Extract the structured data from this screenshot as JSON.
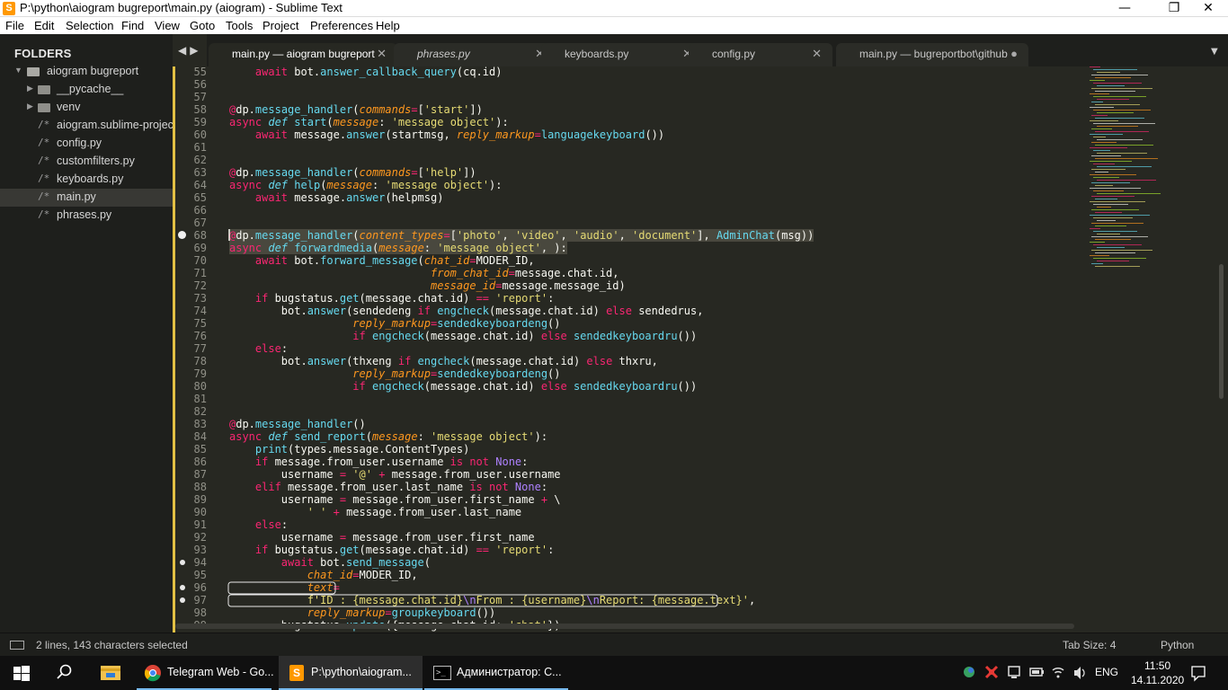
{
  "window": {
    "title": "P:\\python\\aiogram bugreport\\main.py (aiogram) - Sublime Text",
    "minimize": "—",
    "maximize": "❐",
    "close": "✕"
  },
  "menu": [
    "File",
    "Edit",
    "Selection",
    "Find",
    "View",
    "Goto",
    "Tools",
    "Project",
    "Preferences",
    "Help"
  ],
  "sidebar": {
    "header": "FOLDERS",
    "items": [
      {
        "label": "aiogram bugreport",
        "kind": "folder-open",
        "depth": 0
      },
      {
        "label": "__pycache__",
        "kind": "folder",
        "depth": 1
      },
      {
        "label": "venv",
        "kind": "folder",
        "depth": 1
      },
      {
        "label": "aiogram.sublime-project",
        "kind": "file",
        "depth": 1
      },
      {
        "label": "config.py",
        "kind": "file",
        "depth": 1
      },
      {
        "label": "customfilters.py",
        "kind": "file",
        "depth": 1
      },
      {
        "label": "keyboards.py",
        "kind": "file",
        "depth": 1
      },
      {
        "label": "main.py",
        "kind": "file",
        "depth": 1,
        "selected": true
      },
      {
        "label": "phrases.py",
        "kind": "file",
        "depth": 1
      }
    ],
    "nav_back": "◀",
    "nav_forward": "▶"
  },
  "tabs": [
    {
      "label": "main.py — aiogram bugreport",
      "close": "✕",
      "active": true
    },
    {
      "label": "phrases.py",
      "close": "✕",
      "italic": true
    },
    {
      "label": "keyboards.py",
      "close": "✕"
    },
    {
      "label": "config.py",
      "close": "✕"
    },
    {
      "label": "main.py — bugreportbot\\github",
      "close": "●"
    }
  ],
  "tab_dropdown": "▼",
  "code_lines": [
    {
      "n": "55",
      "html": "    <span class=\"kw\">await</span> bot.<span class=\"f\">answer_callback_query</span>(cq.id)"
    },
    {
      "n": "56",
      "html": ""
    },
    {
      "n": "57",
      "html": ""
    },
    {
      "n": "58",
      "html": "<span class=\"kw\">@</span>dp.<span class=\"f\">message_handler</span>(<span class=\"p\">commands</span><span class=\"kw\">=</span>[<span class=\"s\">'start'</span>])"
    },
    {
      "n": "59",
      "html": "<span class=\"kw\">async</span> <span class=\"k\">def</span> <span class=\"f\">start</span>(<span class=\"p\">message</span>: <span class=\"s\">'message object'</span>):"
    },
    {
      "n": "60",
      "html": "    <span class=\"kw\">await</span> message.<span class=\"f\">answer</span>(startmsg, <span class=\"p\">reply_markup</span><span class=\"kw\">=</span><span class=\"f\">languagekeyboard</span>())"
    },
    {
      "n": "61",
      "html": ""
    },
    {
      "n": "62",
      "html": ""
    },
    {
      "n": "63",
      "html": "<span class=\"kw\">@</span>dp.<span class=\"f\">message_handler</span>(<span class=\"p\">commands</span><span class=\"kw\">=</span>[<span class=\"s\">'help'</span>])"
    },
    {
      "n": "64",
      "html": "<span class=\"kw\">async</span> <span class=\"k\">def</span> <span class=\"f\">help</span>(<span class=\"p\">message</span>: <span class=\"s\">'message object'</span>):"
    },
    {
      "n": "65",
      "html": "    <span class=\"kw\">await</span> message.<span class=\"f\">answer</span>(helpmsg)"
    },
    {
      "n": "66",
      "html": ""
    },
    {
      "n": "67",
      "html": ""
    },
    {
      "n": "68",
      "dot": "big",
      "html": "<span class=\"hl\"><span class=\"kw\">@</span>dp.<span class=\"f\">message_handler</span>(<span class=\"p\">content_types</span><span class=\"kw\">=</span>[<span class=\"s\">'photo'</span>, <span class=\"s\">'video'</span>, <span class=\"s\">'audio'</span>, <span class=\"s\">'document'</span>], <span class=\"f\">AdminChat</span>(msg))</span>"
    },
    {
      "n": "69",
      "html": "<span class=\"hl\"><span class=\"kw\">async</span> <span class=\"k\">def</span> <span class=\"f\">forwardmedia</span>(<span class=\"p\">message</span>: <span class=\"s\">'message object'</span>, ):</span>"
    },
    {
      "n": "70",
      "html": "    <span class=\"kw\">await</span> bot.<span class=\"f\">forward_message</span>(<span class=\"p\">chat_id</span><span class=\"kw\">=</span>MODER_ID,"
    },
    {
      "n": "71",
      "html": "                               <span class=\"p\">from_chat_id</span><span class=\"kw\">=</span>message.chat.id,"
    },
    {
      "n": "72",
      "html": "                               <span class=\"p\">message_id</span><span class=\"kw\">=</span>message.message_id)"
    },
    {
      "n": "73",
      "html": "    <span class=\"kw\">if</span> bugstatus.<span class=\"f\">get</span>(message.chat.id) <span class=\"kw\">==</span> <span class=\"s\">'report'</span>:"
    },
    {
      "n": "74",
      "html": "        bot.<span class=\"f\">answer</span>(sendedeng <span class=\"kw\">if</span> <span class=\"f\">engcheck</span>(message.chat.id) <span class=\"kw\">else</span> sendedrus,"
    },
    {
      "n": "75",
      "html": "                   <span class=\"p\">reply_markup</span><span class=\"kw\">=</span><span class=\"f\">sendedkeyboardeng</span>()"
    },
    {
      "n": "76",
      "html": "                   <span class=\"kw\">if</span> <span class=\"f\">engcheck</span>(message.chat.id) <span class=\"kw\">else</span> <span class=\"f\">sendedkeyboardru</span>())"
    },
    {
      "n": "77",
      "html": "    <span class=\"kw\">else</span>:"
    },
    {
      "n": "78",
      "html": "        bot.<span class=\"f\">answer</span>(thxeng <span class=\"kw\">if</span> <span class=\"f\">engcheck</span>(message.chat.id) <span class=\"kw\">else</span> thxru,"
    },
    {
      "n": "79",
      "html": "                   <span class=\"p\">reply_markup</span><span class=\"kw\">=</span><span class=\"f\">sendedkeyboardeng</span>()"
    },
    {
      "n": "80",
      "html": "                   <span class=\"kw\">if</span> <span class=\"f\">engcheck</span>(message.chat.id) <span class=\"kw\">else</span> <span class=\"f\">sendedkeyboardru</span>())"
    },
    {
      "n": "81",
      "html": ""
    },
    {
      "n": "82",
      "html": ""
    },
    {
      "n": "83",
      "html": "<span class=\"kw\">@</span>dp.<span class=\"f\">message_handler</span>()"
    },
    {
      "n": "84",
      "html": "<span class=\"kw\">async</span> <span class=\"k\">def</span> <span class=\"f\">send_report</span>(<span class=\"p\">message</span>: <span class=\"s\">'message object'</span>):"
    },
    {
      "n": "85",
      "html": "    <span class=\"f\">print</span>(types.message.ContentTypes)"
    },
    {
      "n": "86",
      "html": "    <span class=\"kw\">if</span> message.from_user.username <span class=\"kw\">is not</span> <span class=\"c\">None</span>:"
    },
    {
      "n": "87",
      "html": "        username <span class=\"kw\">=</span> <span class=\"s\">'@'</span> <span class=\"kw\">+</span> message.from_user.username"
    },
    {
      "n": "88",
      "html": "    <span class=\"kw\">elif</span> message.from_user.last_name <span class=\"kw\">is not</span> <span class=\"c\">None</span>:"
    },
    {
      "n": "89",
      "html": "        username <span class=\"kw\">=</span> message.from_user.first_name <span class=\"kw\">+</span> \\"
    },
    {
      "n": "90",
      "html": "            <span class=\"s\">' '</span> <span class=\"kw\">+</span> message.from_user.last_name"
    },
    {
      "n": "91",
      "html": "    <span class=\"kw\">else</span>:"
    },
    {
      "n": "92",
      "html": "        username <span class=\"kw\">=</span> message.from_user.first_name"
    },
    {
      "n": "93",
      "html": "    <span class=\"kw\">if</span> bugstatus.<span class=\"f\">get</span>(message.chat.id) <span class=\"kw\">==</span> <span class=\"s\">'report'</span>:"
    },
    {
      "n": "94",
      "dot": "small",
      "html": "        <span class=\"kw\">await</span> bot.<span class=\"f\">send_message</span>("
    },
    {
      "n": "95",
      "html": "            <span class=\"p\">chat_id</span><span class=\"kw\">=</span>MODER_ID,"
    },
    {
      "n": "96",
      "dot": "small",
      "html": "            <span class=\"p\">text</span><span class=\"kw\">=</span>"
    },
    {
      "n": "97",
      "dot": "small",
      "html": "            <span class=\"s\">f'ID : {message.chat.id}</span><span class=\"c\">\\n</span><span class=\"s\">From : {username}</span><span class=\"c\">\\n</span><span class=\"s\">Report: {message.text}'</span>,"
    },
    {
      "n": "98",
      "html": "            <span class=\"p\">reply_markup</span><span class=\"kw\">=</span><span class=\"f\">groupkeyboard</span>())"
    },
    {
      "n": "99",
      "html": "        bugstatus.<span class=\"f\">update</span>({message.chat.id: <span class=\"s\">'chat'</span>})"
    }
  ],
  "status": {
    "selection": "2 lines, 143 characters selected",
    "tab_size": "Tab Size: 4",
    "syntax": "Python"
  },
  "taskbar": {
    "tasks": [
      {
        "label": "Telegram Web - Go..."
      },
      {
        "label": "P:\\python\\aiogram...",
        "active": true
      },
      {
        "label": "Администратор: C..."
      }
    ],
    "lang": "ENG",
    "time": "11:50",
    "date": "14.11.2020"
  },
  "colors": {
    "bg": "#272822",
    "sidebar": "#1e1f1c",
    "keyword": "#f92672",
    "string": "#e6db74",
    "func": "#66d9ef",
    "param": "#fd971f",
    "const": "#ae81ff",
    "modified": "#e2c044"
  }
}
